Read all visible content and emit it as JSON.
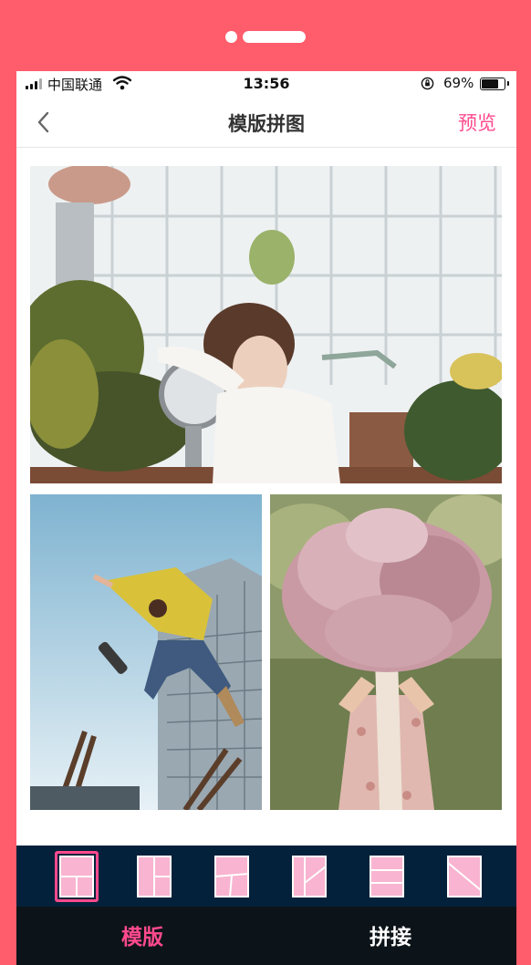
{
  "status_bar": {
    "carrier": "中国联通",
    "time": "13:56",
    "battery_percent": "69%",
    "battery_level": 0.69
  },
  "nav": {
    "title": "模版拼图",
    "preview_label": "预览",
    "back_icon": "chevron-left-icon"
  },
  "colors": {
    "accent": "#ff4a8d",
    "frame": "#ff5c6c",
    "template_bar": "#03213a",
    "template_icon_fill": "#f8b4d0"
  },
  "collage": {
    "photos": [
      {
        "subject": "woman at desk with plants and lamp"
      },
      {
        "subject": "man in yellow jacket jumping with skateboard"
      },
      {
        "subject": "woman holding bouquet of pink lilac flowers"
      }
    ]
  },
  "templates": {
    "selected_index": 0,
    "items": [
      {
        "icon": "layout-top-two-bottom-icon"
      },
      {
        "icon": "layout-left-two-right-icon"
      },
      {
        "icon": "layout-top-wide-split-icon"
      },
      {
        "icon": "layout-diagonal-split-icon"
      },
      {
        "icon": "layout-three-rows-icon"
      },
      {
        "icon": "layout-diagonal-line-icon"
      }
    ]
  },
  "tabs": {
    "items": [
      {
        "label": "模版",
        "active": true
      },
      {
        "label": "拼接",
        "active": false
      }
    ]
  }
}
